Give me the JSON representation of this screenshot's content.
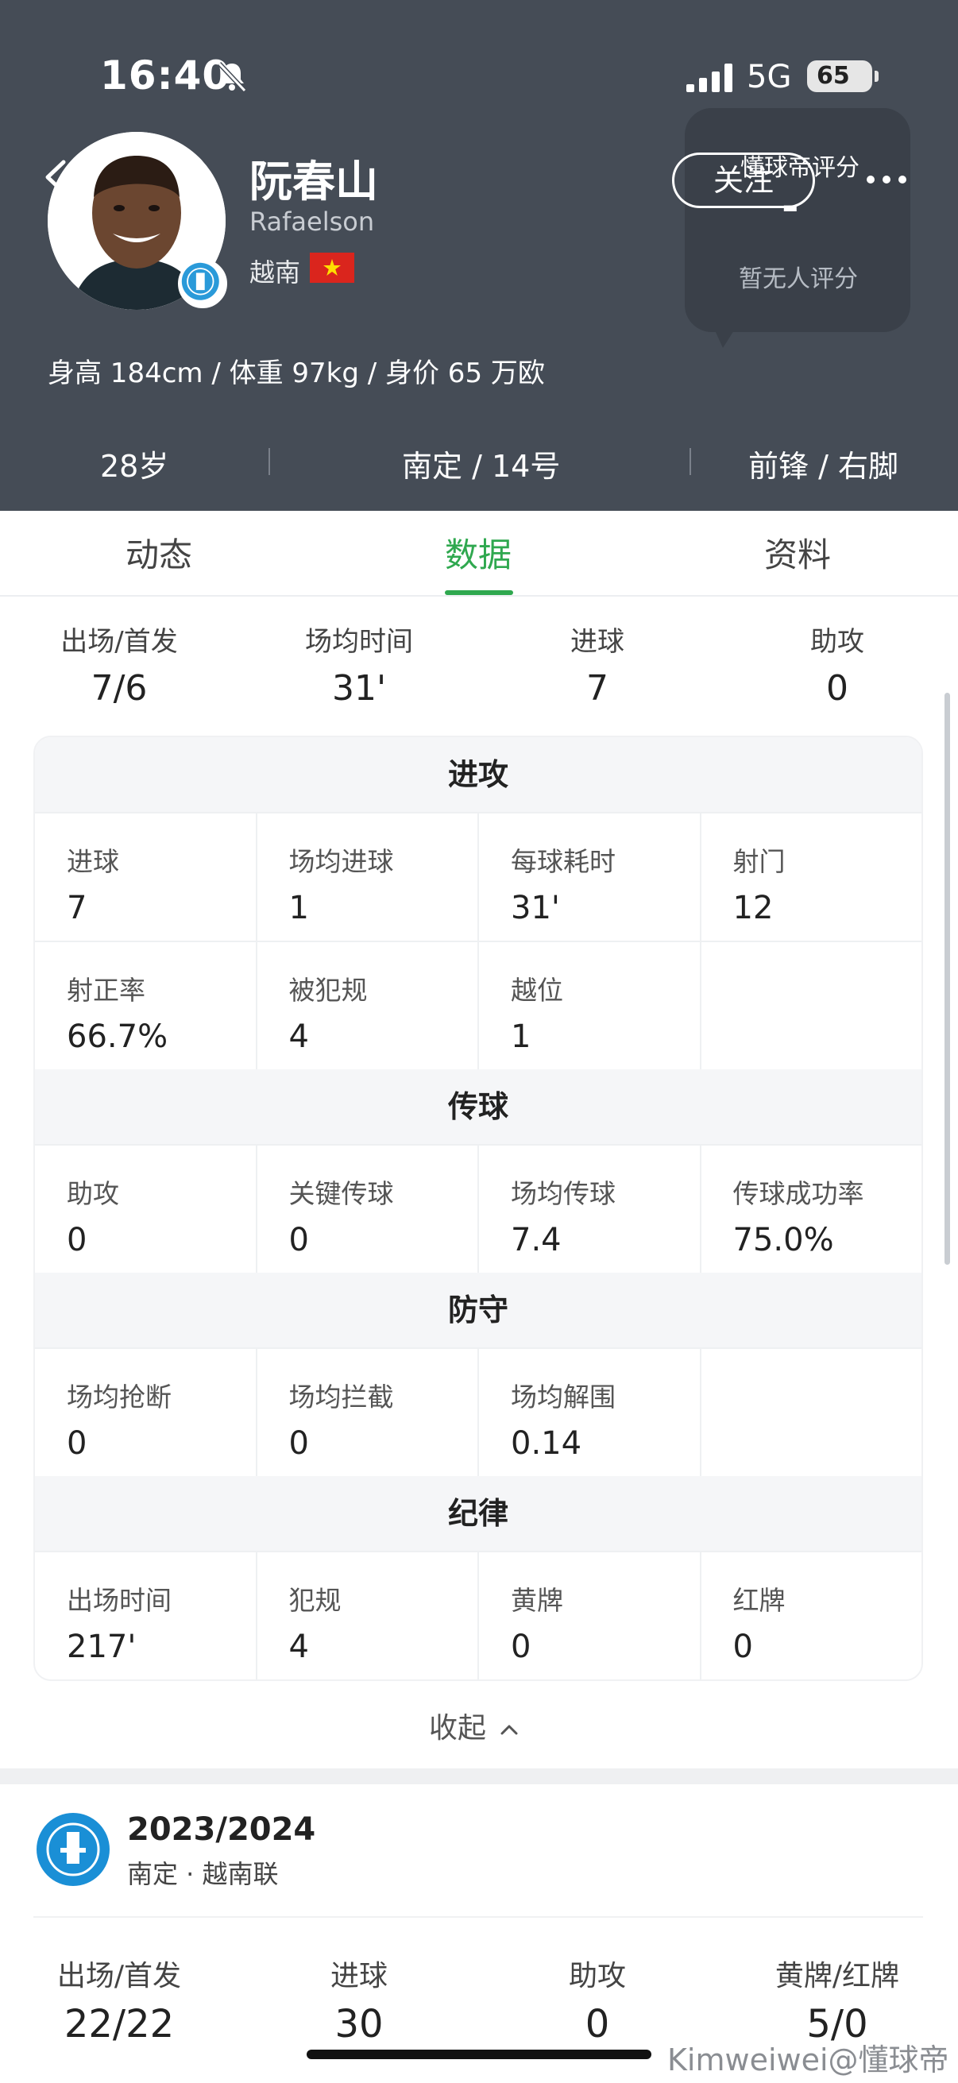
{
  "status_bar": {
    "time": "16:40",
    "network": "5G",
    "battery": "65"
  },
  "player": {
    "name": "阮春山",
    "latin_name": "Rafaelson",
    "nationality": "越南",
    "body_info": "身高 184cm / 体重 97kg / 身价 65 万欧",
    "age": "28岁",
    "club_number": "南定 / 14号",
    "position_foot": "前锋 / 右脚"
  },
  "header_actions": {
    "follow": "关注"
  },
  "rating": {
    "title": "懂球帝评分",
    "value": "-",
    "note": "暂无人评分"
  },
  "tabs": [
    {
      "label": "动态",
      "active": false
    },
    {
      "label": "数据",
      "active": true
    },
    {
      "label": "资料",
      "active": false
    }
  ],
  "summary": [
    {
      "label": "出场/首发",
      "value": "7/6"
    },
    {
      "label": "场均时间",
      "value": "31'"
    },
    {
      "label": "进球",
      "value": "7"
    },
    {
      "label": "助攻",
      "value": "0"
    }
  ],
  "sections": [
    {
      "title": "进攻",
      "rows": [
        [
          {
            "label": "进球",
            "value": "7"
          },
          {
            "label": "场均进球",
            "value": "1"
          },
          {
            "label": "每球耗时",
            "value": "31'"
          },
          {
            "label": "射门",
            "value": "12"
          }
        ],
        [
          {
            "label": "射正率",
            "value": "66.7%"
          },
          {
            "label": "被犯规",
            "value": "4"
          },
          {
            "label": "越位",
            "value": "1"
          },
          {
            "label": "",
            "value": ""
          }
        ]
      ]
    },
    {
      "title": "传球",
      "rows": [
        [
          {
            "label": "助攻",
            "value": "0"
          },
          {
            "label": "关键传球",
            "value": "0"
          },
          {
            "label": "场均传球",
            "value": "7.4"
          },
          {
            "label": "传球成功率",
            "value": "75.0%"
          }
        ]
      ]
    },
    {
      "title": "防守",
      "rows": [
        [
          {
            "label": "场均抢断",
            "value": "0"
          },
          {
            "label": "场均拦截",
            "value": "0"
          },
          {
            "label": "场均解围",
            "value": "0.14"
          },
          {
            "label": "",
            "value": ""
          }
        ]
      ]
    },
    {
      "title": "纪律",
      "rows": [
        [
          {
            "label": "出场时间",
            "value": "217'"
          },
          {
            "label": "犯规",
            "value": "4"
          },
          {
            "label": "黄牌",
            "value": "0"
          },
          {
            "label": "红牌",
            "value": "0"
          }
        ]
      ]
    }
  ],
  "collapse_label": "收起",
  "season": {
    "title": "2023/2024",
    "subtitle": "南定 · 越南联",
    "stats": [
      {
        "label": "出场/首发",
        "value": "22/22"
      },
      {
        "label": "进球",
        "value": "30"
      },
      {
        "label": "助攻",
        "value": "0"
      },
      {
        "label": "黄牌/红牌",
        "value": "5/0"
      }
    ]
  },
  "watermark": "Kimweiwei@懂球帝",
  "colors": {
    "header_bg": "#454c56",
    "accent": "#2fa84f",
    "flag_red": "#da251d"
  }
}
